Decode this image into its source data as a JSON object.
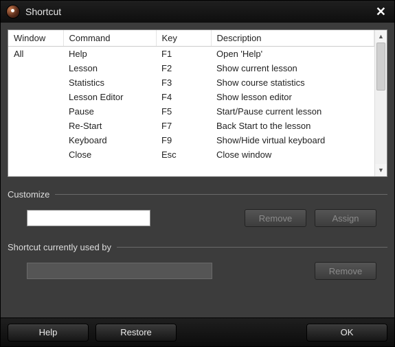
{
  "titlebar": {
    "title": "Shortcut"
  },
  "table": {
    "headers": {
      "window": "Window",
      "command": "Command",
      "key": "Key",
      "description": "Description"
    },
    "window_label": "All",
    "rows": [
      {
        "command": "Help",
        "key": "F1",
        "description": "Open 'Help'"
      },
      {
        "command": "Lesson",
        "key": "F2",
        "description": "Show current lesson"
      },
      {
        "command": "Statistics",
        "key": "F3",
        "description": "Show course statistics"
      },
      {
        "command": "Lesson Editor",
        "key": "F4",
        "description": "Show lesson editor"
      },
      {
        "command": "Pause",
        "key": "F5",
        "description": "Start/Pause current lesson"
      },
      {
        "command": "Re-Start",
        "key": "F7",
        "description": "Back Start to the lesson"
      },
      {
        "command": "Keyboard",
        "key": "F9",
        "description": "Show/Hide virtual keyboard"
      },
      {
        "command": "Close",
        "key": "Esc",
        "description": "Close window"
      }
    ]
  },
  "customize": {
    "legend": "Customize",
    "input_value": "",
    "remove_label": "Remove",
    "assign_label": "Assign"
  },
  "used_by": {
    "legend": "Shortcut currently used by",
    "input_value": "",
    "remove_label": "Remove"
  },
  "footer": {
    "help_label": "Help",
    "restore_label": "Restore",
    "ok_label": "OK"
  }
}
